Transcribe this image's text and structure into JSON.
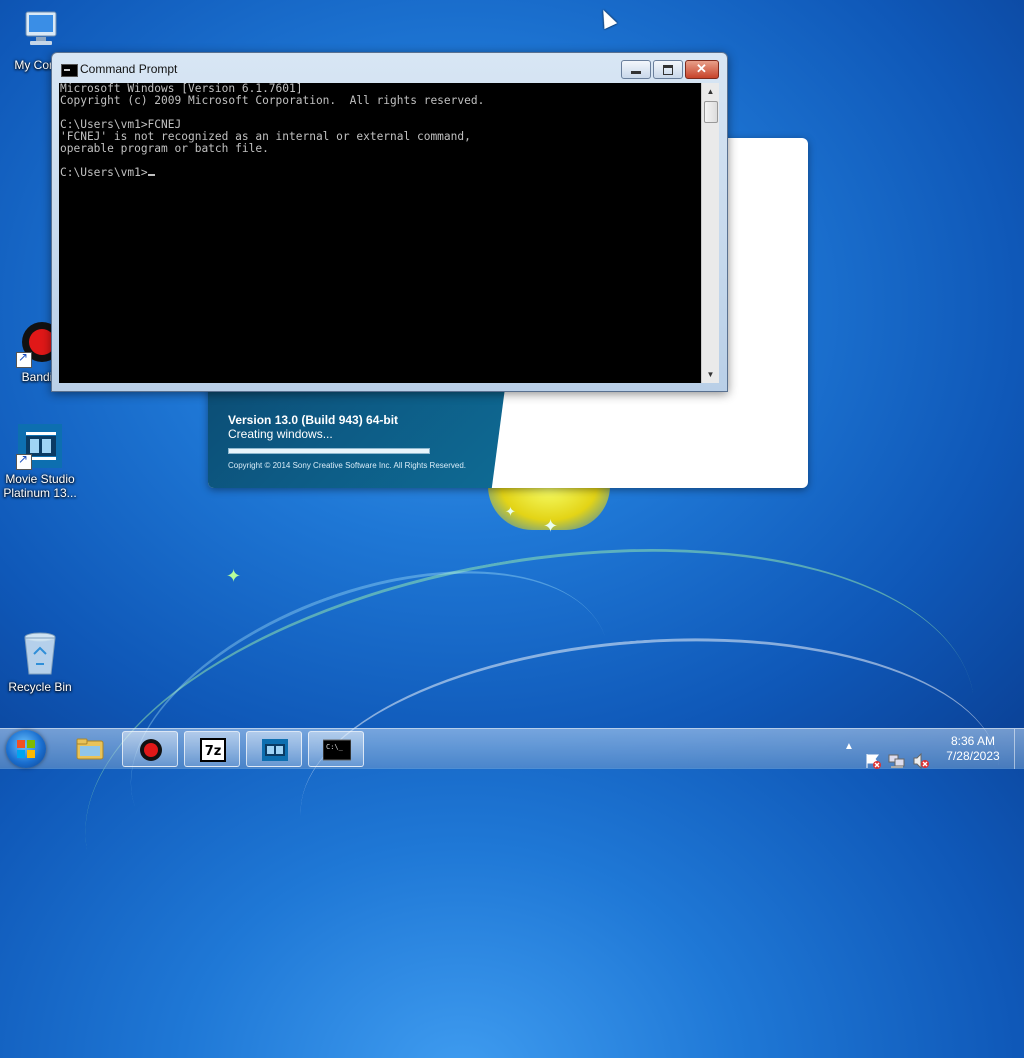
{
  "desktop": {
    "icons": [
      {
        "label": "My Comp"
      },
      {
        "label": "Bandic"
      },
      {
        "label": "Movie Studio Platinum 13..."
      },
      {
        "label": "Recycle Bin"
      }
    ]
  },
  "splash": {
    "version": "Version 13.0 (Build 943) 64-bit",
    "status": "Creating windows...",
    "progress": 1.0,
    "copyright": "Copyright © 2014 Sony Creative Software Inc. All Rights Reserved."
  },
  "cmd": {
    "title": "Command Prompt",
    "lines": [
      "Microsoft Windows [Version 6.1.7601]",
      "Copyright (c) 2009 Microsoft Corporation.  All rights reserved.",
      "",
      "C:\\Users\\vm1>FCNEJ",
      "'FCNEJ' is not recognized as an internal or external command,",
      "operable program or batch file.",
      "",
      "C:\\Users\\vm1>"
    ]
  },
  "taskbar": {
    "clock_time": "8:36 AM",
    "clock_date": "7/28/2023",
    "cmd_glyph": "C:\\_"
  },
  "colors": {
    "console_bg": "#000000",
    "console_fg": "#c0c0c0",
    "close_button": "#c7432a"
  }
}
